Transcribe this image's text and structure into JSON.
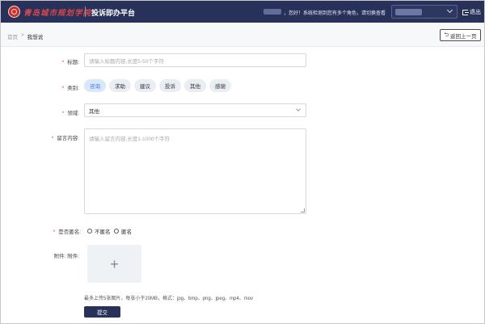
{
  "header": {
    "logo_text": "青岛城市规划学院",
    "app_title": "投诉即办平台",
    "notice": "，您好！系统检测到您有多个角色，请切换查看",
    "logout_label": "退出"
  },
  "breadcrumb": {
    "home": "首页",
    "separator": ">",
    "current": "我想说",
    "back_label": "返回上一页"
  },
  "form": {
    "title": {
      "label": "标题:",
      "placeholder": "请输入标题内容,长度5-50个字符"
    },
    "category": {
      "label": "类别:",
      "options": [
        "咨询",
        "求助",
        "建议",
        "投诉",
        "其他",
        "感谢"
      ],
      "selected": "咨询"
    },
    "domain": {
      "label": "领域:",
      "value": "其他"
    },
    "content": {
      "label": "留言内容:",
      "placeholder": "请输入留言内容,长度1-1000个字符"
    },
    "anonymous": {
      "label": "是否匿名:",
      "options": [
        "不匿名",
        "匿名"
      ]
    },
    "attachment": {
      "label": "附件: 附件:",
      "plus": "+"
    },
    "hint": "最多上传5张图片，每张小于20MB，格式：jpg、bmp、png、jpeg、mp4、mov",
    "submit_label": "提交"
  },
  "colors": {
    "header_bg": "#27315a",
    "required": "#e03c3c",
    "accent": "#3b7ddd"
  }
}
